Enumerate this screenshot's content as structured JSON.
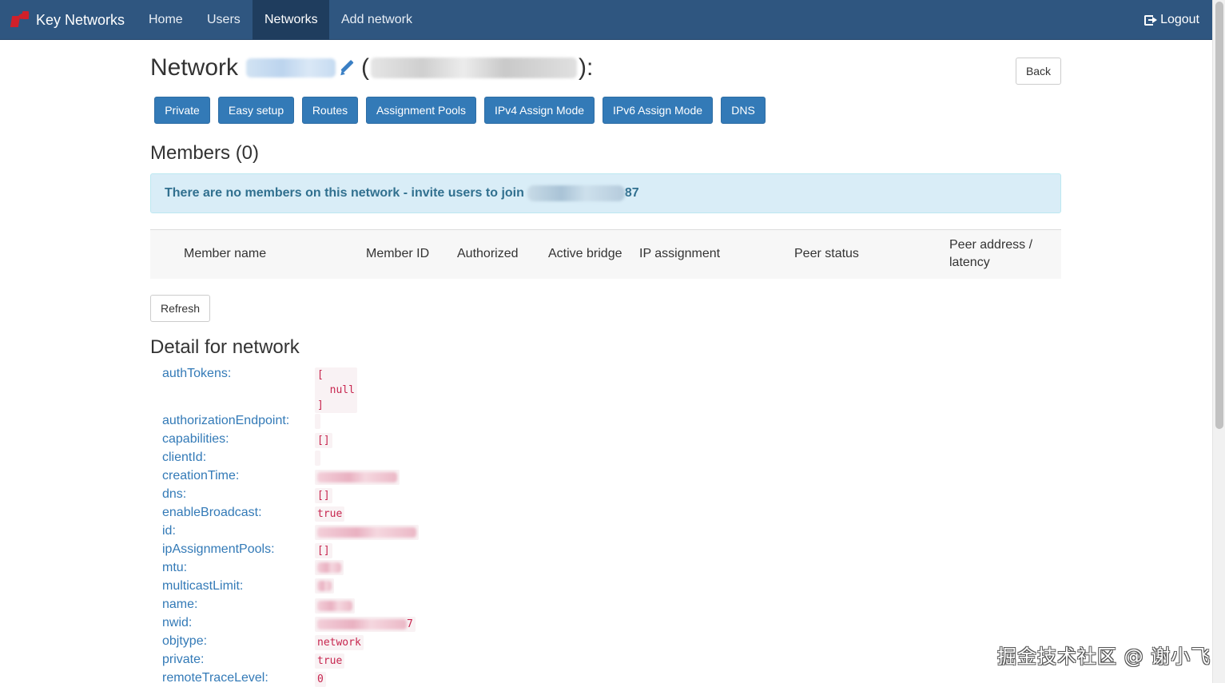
{
  "navbar": {
    "brand": "Key Networks",
    "items": [
      "Home",
      "Users",
      "Networks",
      "Add network"
    ],
    "active": "Networks",
    "logout": "Logout"
  },
  "header": {
    "title_prefix": "Network",
    "paren_open": "(",
    "suffix": "):",
    "back": "Back"
  },
  "tabs": [
    "Private",
    "Easy setup",
    "Routes",
    "Assignment Pools",
    "IPv4 Assign Mode",
    "IPv6 Assign Mode",
    "DNS"
  ],
  "members": {
    "title": "Members (0)",
    "alert": "There are no members on this network - invite users to join",
    "alert_tail": "87",
    "columns": [
      "Member name",
      "Member ID",
      "Authorized",
      "Active bridge",
      "IP assignment",
      "Peer status",
      "Peer address /",
      "latency"
    ],
    "refresh": "Refresh"
  },
  "detail": {
    "title": "Detail for network",
    "rows": [
      {
        "key": "authTokens:",
        "value": "[\n  null\n]"
      },
      {
        "key": "authorizationEndpoint:",
        "value": ""
      },
      {
        "key": "capabilities:",
        "value": "[]"
      },
      {
        "key": "clientId:",
        "value": ""
      },
      {
        "key": "creationTime:",
        "value": ""
      },
      {
        "key": "dns:",
        "value": "[]"
      },
      {
        "key": "enableBroadcast:",
        "value": "true"
      },
      {
        "key": "id:",
        "value": ""
      },
      {
        "key": "ipAssignmentPools:",
        "value": "[]"
      },
      {
        "key": "mtu:",
        "value": ""
      },
      {
        "key": "multicastLimit:",
        "value": ""
      },
      {
        "key": "name:",
        "value": ""
      },
      {
        "key": "nwid:",
        "value": "7"
      },
      {
        "key": "objtype:",
        "value": "network"
      },
      {
        "key": "private:",
        "value": "true"
      },
      {
        "key": "remoteTraceLevel:",
        "value": "0"
      }
    ]
  },
  "watermark": "掘金技术社区 @ 谢小飞"
}
